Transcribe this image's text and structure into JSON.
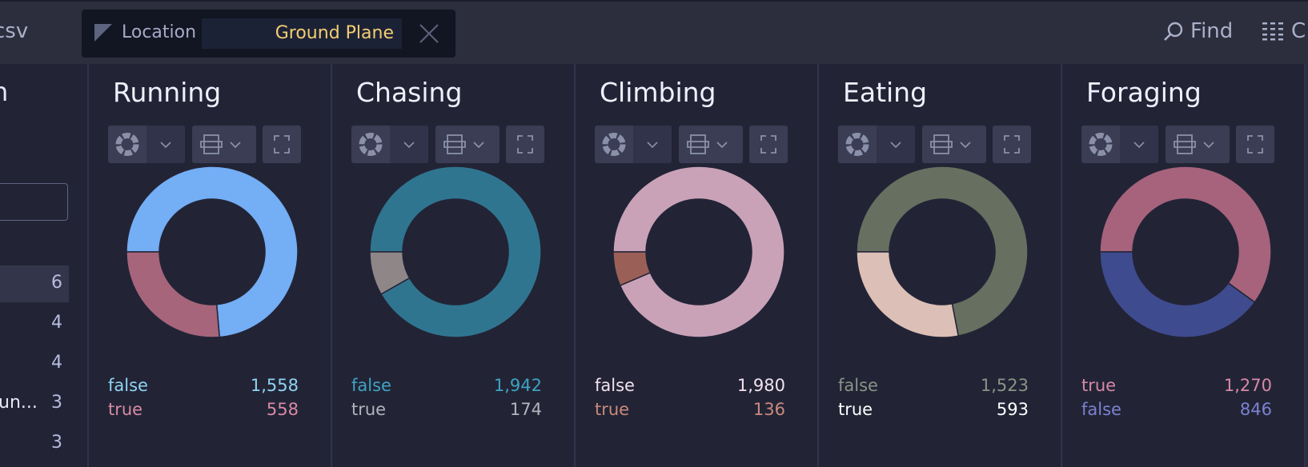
{
  "topbar": {
    "file_name": "csv",
    "filter": {
      "label": "Location",
      "value": "Ground Plane",
      "icon": "filter-triangle-icon",
      "close_icon": "close-icon"
    },
    "find_label": "Find",
    "columns_label": "C"
  },
  "sidebar": {
    "title": "n",
    "search_value": "",
    "rows": [
      {
        "label": "",
        "count": "6",
        "selected": true
      },
      {
        "label": "",
        "count": "4"
      },
      {
        "label": "",
        "count": "4"
      },
      {
        "label": "un...",
        "count": "3"
      },
      {
        "label": "",
        "count": "3"
      }
    ]
  },
  "chart_data": [
    {
      "type": "pie",
      "title": "Running",
      "slices": [
        {
          "label": "false",
          "value": 1558,
          "color": "#74aef5",
          "text": "#8fd3f3",
          "display": "1,558"
        },
        {
          "label": "true",
          "value": 558,
          "color": "#a6657b",
          "text": "#d98aa5",
          "display": "558"
        }
      ]
    },
    {
      "type": "pie",
      "title": "Chasing",
      "slices": [
        {
          "label": "false",
          "value": 1942,
          "color": "#307590",
          "text": "#3ea3c2",
          "display": "1,942"
        },
        {
          "label": "true",
          "value": 174,
          "color": "#8e8687",
          "text": "#b3b3bb",
          "display": "174"
        }
      ]
    },
    {
      "type": "pie",
      "title": "Climbing",
      "slices": [
        {
          "label": "false",
          "value": 1980,
          "color": "#c9a2b8",
          "text": "#f3e2ee",
          "display": "1,980"
        },
        {
          "label": "true",
          "value": 136,
          "color": "#9a6058",
          "text": "#cb8a7c",
          "display": "136"
        }
      ]
    },
    {
      "type": "pie",
      "title": "Eating",
      "slices": [
        {
          "label": "false",
          "value": 1523,
          "color": "#676f60",
          "text": "#8c9385",
          "display": "1,523"
        },
        {
          "label": "true",
          "value": 593,
          "color": "#dcbfb6",
          "text": "#ffffff",
          "display": "593"
        }
      ]
    },
    {
      "type": "pie",
      "title": "Foraging",
      "slices": [
        {
          "label": "true",
          "value": 1270,
          "color": "#a6637b",
          "text": "#d888a8",
          "display": "1,270"
        },
        {
          "label": "false",
          "value": 846,
          "color": "#3f4b8f",
          "text": "#7b82cf",
          "display": "846"
        }
      ]
    }
  ]
}
